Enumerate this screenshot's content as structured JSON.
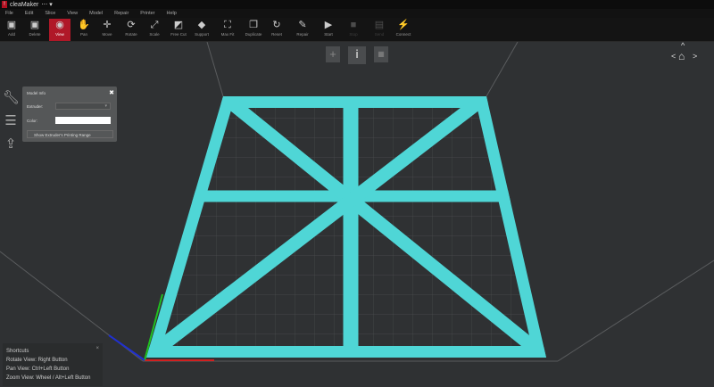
{
  "app": {
    "title": "cleaMaker",
    "title_suffix": "⋯ ▾"
  },
  "menu": [
    "File",
    "Edit",
    "Slice",
    "View",
    "Model",
    "Repair",
    "Printer",
    "Help"
  ],
  "toolbar": [
    {
      "label": "Add",
      "icon": "add-model-icon",
      "glyph": "▣"
    },
    {
      "label": "Delete",
      "icon": "delete-icon",
      "glyph": "▣"
    },
    {
      "label": "View",
      "icon": "eye-icon",
      "glyph": "◉",
      "active": true
    },
    {
      "label": "Pan",
      "icon": "hand-icon",
      "glyph": "✋"
    },
    {
      "label": "Move",
      "icon": "move-icon",
      "glyph": "✛"
    },
    {
      "label": "Rotate",
      "icon": "rotate-icon",
      "glyph": "⟳"
    },
    {
      "label": "Scale",
      "icon": "scale-icon",
      "glyph": "⤢"
    },
    {
      "label": "Free Cut",
      "icon": "cut-icon",
      "glyph": "◩"
    },
    {
      "label": "Support",
      "icon": "support-icon",
      "glyph": "◆"
    },
    {
      "label": "Max Fit",
      "icon": "max-fit-icon",
      "glyph": "⛶"
    },
    {
      "label": "Duplicate",
      "icon": "duplicate-icon",
      "glyph": "❐"
    },
    {
      "label": "Reset",
      "icon": "reset-icon",
      "glyph": "↻"
    },
    {
      "label": "Repair",
      "icon": "wrench-icon",
      "glyph": "✎"
    },
    {
      "label": "Start",
      "icon": "play-icon",
      "glyph": "▶"
    },
    {
      "label": "Stop",
      "icon": "stop-icon",
      "glyph": "■",
      "disabled": true
    },
    {
      "label": "Send",
      "icon": "send-icon",
      "glyph": "▤",
      "disabled": true
    },
    {
      "label": "Connect",
      "icon": "connect-icon",
      "glyph": "⚡"
    }
  ],
  "model_info": {
    "title": "Model Info",
    "extruder_label": "Extruder:",
    "extruder_value": "▾",
    "color_label": "Color:",
    "show_range": "Show Extruder's Printing Range"
  },
  "shortcuts": {
    "title": "Shortcuts",
    "rotate": "Rotate View: Right Button",
    "pan": "Pan View: Ctrl+Left Button",
    "zoom": "Zoom View: Wheel / Alt+Left Button"
  },
  "colors": {
    "model": "#4fd6d6",
    "accent": "#b01828",
    "x_axis": "#d02020",
    "y_axis": "#20c020",
    "z_axis": "#2030d0"
  }
}
